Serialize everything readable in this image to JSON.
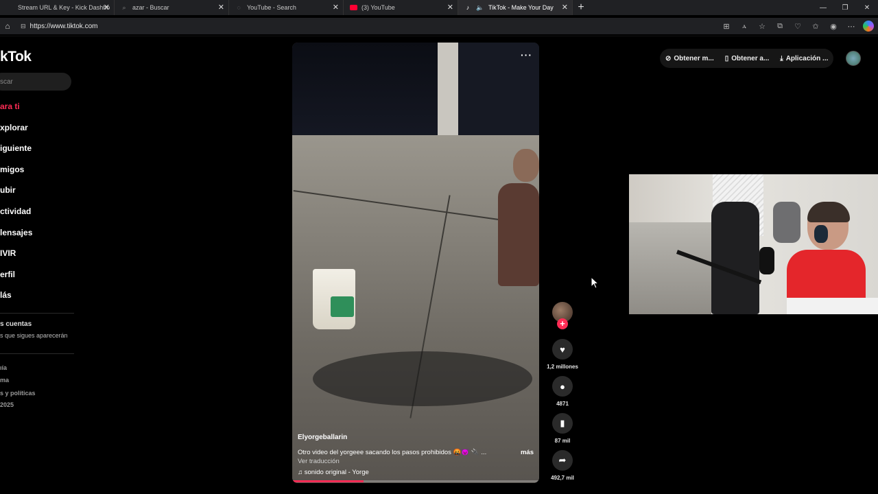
{
  "browser": {
    "tabs": [
      {
        "label": "Stream URL & Key - Kick Dashbo",
        "icon": "kick-icon",
        "active": false
      },
      {
        "label": "azar - Buscar",
        "icon": "search-icon",
        "active": false
      },
      {
        "label": "YouTube - Search",
        "icon": "globe-icon",
        "active": false
      },
      {
        "label": "(3) YouTube",
        "icon": "youtube-icon",
        "active": false
      },
      {
        "label": "TikTok - Make Your Day",
        "icon": "tiktok-icon",
        "active": true
      }
    ],
    "url": "https://www.tiktok.com",
    "new_tab": "+",
    "window_controls": {
      "minimize": "—",
      "restore": "❐",
      "close": "✕"
    }
  },
  "sidebar": {
    "logo": "kTok",
    "search_placeholder": "scar",
    "nav": [
      {
        "label": "ara ti",
        "active": true
      },
      {
        "label": "xplorar",
        "active": false
      },
      {
        "label": "iguiente",
        "active": false
      },
      {
        "label": "migos",
        "active": false
      },
      {
        "label": "ubir",
        "active": false
      },
      {
        "label": "ctividad",
        "active": false
      },
      {
        "label": "lensajes",
        "active": false
      },
      {
        "label": "IVIR",
        "active": false
      },
      {
        "label": "erfil",
        "active": false
      },
      {
        "label": "lás",
        "active": false
      }
    ],
    "accounts_title": "s cuentas",
    "accounts_sub": "s que sigues aparecerán",
    "footer": [
      "ıía",
      "ma",
      "s y políticas",
      "2025"
    ]
  },
  "video": {
    "username": "Elyorgeballarin",
    "description": "Otro video del yorgeee sacando los pasos prohibidos 🤬😈 🔌 ...",
    "more": "más",
    "translate": "Ver traducción",
    "sound": "♫ sonido original - Yorge",
    "progress": 0.29
  },
  "actions": {
    "likes": "1,2 millones",
    "comments": "4871",
    "saves": "87 mil",
    "shares": "492,7 mil"
  },
  "topright": {
    "btn1": "Obtener m...",
    "btn2": "Obtener a...",
    "btn3": "Aplicación ..."
  },
  "colors": {
    "accent": "#fe2c55",
    "background": "#000000"
  }
}
